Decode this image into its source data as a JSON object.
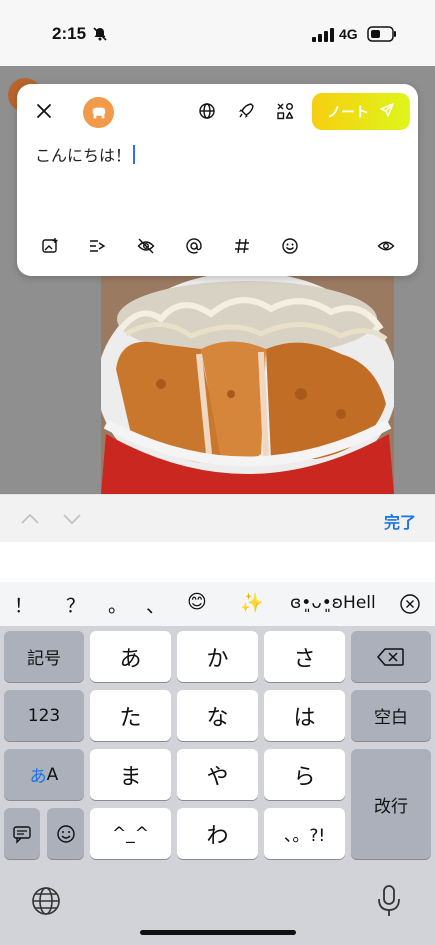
{
  "status_bar": {
    "time": "2:15",
    "network": "4G"
  },
  "composer": {
    "text": "こんにちは！",
    "note_button_label": "ノート"
  },
  "accessory": {
    "done_label": "完了"
  },
  "keyboard": {
    "suggestions": [
      "！",
      "？",
      "。",
      "、",
      "😊",
      "✨",
      "ɞ•͈ᴗ•͈ʚHell"
    ],
    "left_keys": [
      "記号",
      "123",
      "あ",
      "A"
    ],
    "kana_keys": [
      "あ",
      "か",
      "さ",
      "た",
      "な",
      "は",
      "ま",
      "や",
      "ら",
      "^_^",
      "わ",
      "、。?!"
    ],
    "space_label": "空白",
    "return_label": "改行"
  },
  "colors": {
    "accent": "#1a73e8",
    "note_gradient_start": "#f6cf10",
    "note_gradient_end": "#dff51a",
    "avatar": "#f19a4a"
  },
  "icons": [
    "close-icon",
    "globe-icon",
    "rocket-icon",
    "shapes-icon",
    "send-icon",
    "image-add-icon",
    "poll-icon",
    "eye-off-icon",
    "at-icon",
    "hash-icon",
    "emoji-icon",
    "eye-icon",
    "chevron-up-icon",
    "chevron-down-icon",
    "backspace-icon",
    "keyboard-globe-icon",
    "microphone-icon"
  ]
}
